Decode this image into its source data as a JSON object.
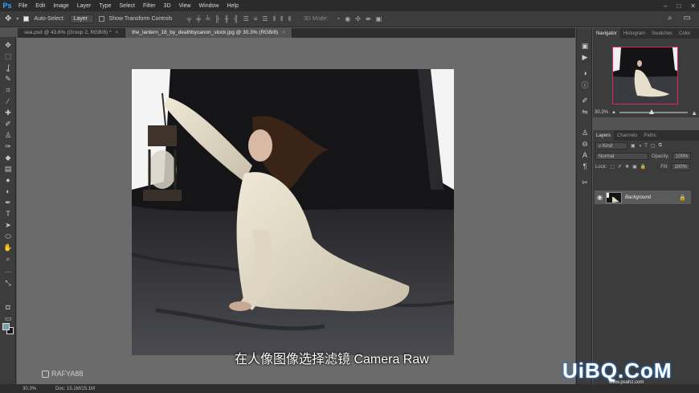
{
  "app": {
    "logo": "Ps",
    "menu": [
      "File",
      "Edit",
      "Image",
      "Layer",
      "Type",
      "Select",
      "Filter",
      "3D",
      "View",
      "Window",
      "Help"
    ],
    "window_controls": [
      "–",
      "□",
      "✕"
    ]
  },
  "options_bar": {
    "auto_select_label": "Auto-Select:",
    "auto_select_value": "Layer",
    "show_transform_label": "Show Transform Controls",
    "mode_label": "3D Mode:",
    "search_icon": "search-icon",
    "workspace_icon": "workspace-icon"
  },
  "tabs": [
    {
      "label": "sea.psd @ 43.6% (Group 2, RGB/8) *",
      "close": "×",
      "active": false
    },
    {
      "label": "the_lantern_18_by_deathbycanon_stock.jpg @ 30.3% (RGB/8)",
      "close": "×",
      "active": true
    }
  ],
  "panels": {
    "navigator_tabs": [
      "Navigator",
      "Histogram",
      "Swatches",
      "Color"
    ],
    "zoom_value": "30.3%",
    "layers_tabs": [
      "Layers",
      "Channels",
      "Paths"
    ],
    "kind_label": "Kind",
    "blend_mode": "Normal",
    "opacity_label": "Opacity:",
    "opacity_value": "100%",
    "lock_label": "Lock:",
    "fill_label": "Fill:",
    "fill_value": "100%",
    "layer_name": "Background"
  },
  "status_bar": {
    "zoom": "30.3%",
    "doc": "Doc: 15.1M/15.1M"
  },
  "overlay": {
    "subtitle": "在人像图像选择滤镜  Camera Raw",
    "credit": "RAFYA88",
    "watermark": "UiBQ.CoM",
    "watermark_sub": "www.psahz.com"
  },
  "colors": {
    "ps_blue": "#31a8ff",
    "foreground_swatch": "#7a9e9f",
    "background_swatch": "#1a1a1a",
    "navigator_frame": "#e0245e"
  }
}
